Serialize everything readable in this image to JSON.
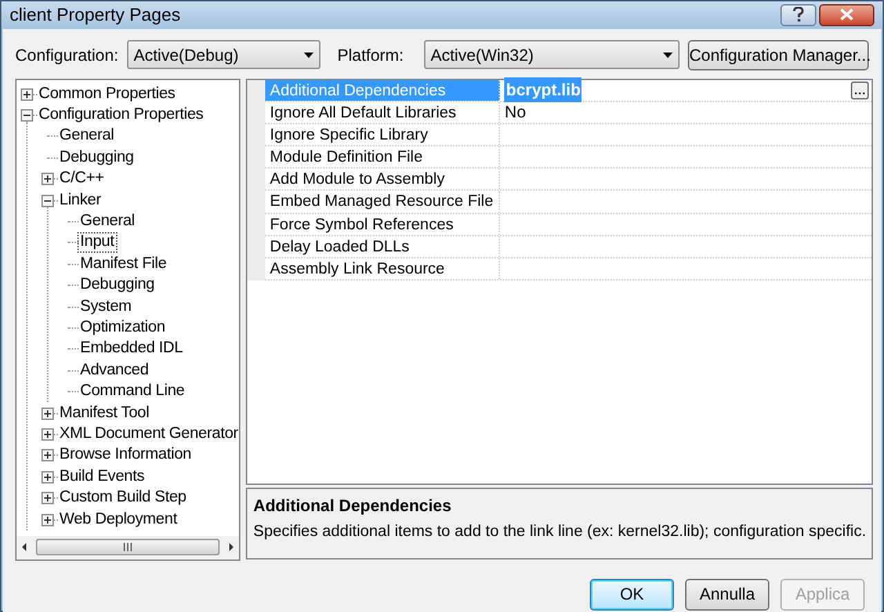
{
  "window": {
    "title": "client Property Pages"
  },
  "configuration": {
    "label": "Configuration:",
    "value": "Active(Debug)"
  },
  "platform": {
    "label": "Platform:",
    "value": "Active(Win32)"
  },
  "configuration_manager_button": "Configuration Manager...",
  "tree": [
    {
      "label": "Common Properties",
      "expanded": false,
      "selected": false
    },
    {
      "label": "Configuration Properties",
      "expanded": true,
      "selected": false,
      "children": [
        {
          "label": "General",
          "selected": false
        },
        {
          "label": "Debugging",
          "selected": false
        },
        {
          "label": "C/C++",
          "expanded": false,
          "selected": false
        },
        {
          "label": "Linker",
          "expanded": true,
          "selected": false,
          "children": [
            {
              "label": "General",
              "selected": false
            },
            {
              "label": "Input",
              "selected": true
            },
            {
              "label": "Manifest File",
              "selected": false
            },
            {
              "label": "Debugging",
              "selected": false
            },
            {
              "label": "System",
              "selected": false
            },
            {
              "label": "Optimization",
              "selected": false
            },
            {
              "label": "Embedded IDL",
              "selected": false
            },
            {
              "label": "Advanced",
              "selected": false
            },
            {
              "label": "Command Line",
              "selected": false
            }
          ]
        },
        {
          "label": "Manifest Tool",
          "expanded": false,
          "selected": false
        },
        {
          "label": "XML Document Generator",
          "expanded": false,
          "selected": false
        },
        {
          "label": "Browse Information",
          "expanded": false,
          "selected": false
        },
        {
          "label": "Build Events",
          "expanded": false,
          "selected": false
        },
        {
          "label": "Custom Build Step",
          "expanded": false,
          "selected": false
        },
        {
          "label": "Web Deployment",
          "expanded": false,
          "selected": false
        }
      ]
    }
  ],
  "properties": [
    {
      "name": "Additional Dependencies",
      "value": "bcrypt.lib",
      "selected": true
    },
    {
      "name": "Ignore All Default Libraries",
      "value": "No",
      "selected": false
    },
    {
      "name": "Ignore Specific Library",
      "selected": false
    },
    {
      "name": "Module Definition File",
      "selected": false
    },
    {
      "name": "Add Module to Assembly",
      "selected": false
    },
    {
      "name": "Embed Managed Resource File",
      "selected": false
    },
    {
      "name": "Force Symbol References",
      "selected": false
    },
    {
      "name": "Delay Loaded DLLs",
      "selected": false
    },
    {
      "name": "Assembly Link Resource",
      "selected": false
    }
  ],
  "description": {
    "title": "Additional Dependencies",
    "text": "Specifies additional items to add to the link line (ex: kernel32.lib); configuration specific."
  },
  "buttons": [
    {
      "label": "OK",
      "disabled": false,
      "default": true
    },
    {
      "label": "Annulla",
      "disabled": false,
      "default": false
    },
    {
      "label": "Applica",
      "disabled": true,
      "default": false
    }
  ]
}
